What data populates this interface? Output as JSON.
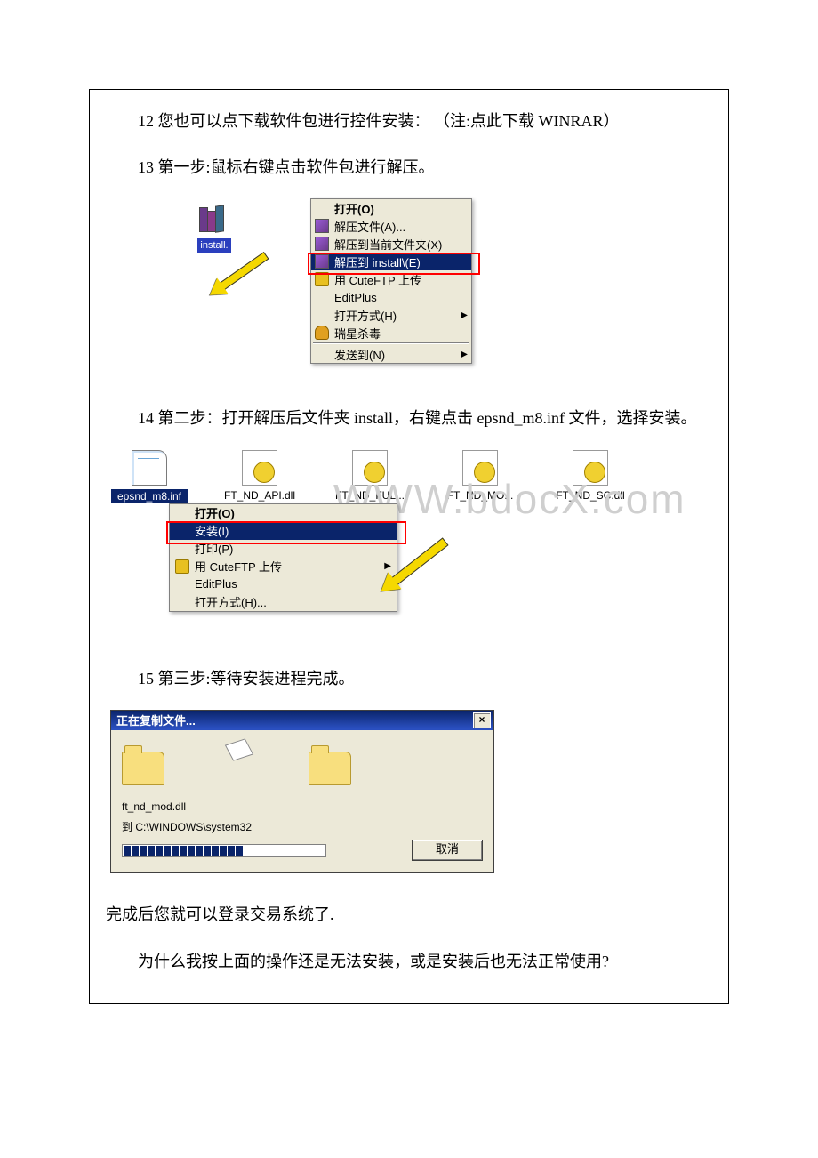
{
  "para": {
    "p12": "12 您也可以点下载软件包进行控件安装：  （注:点此下载 WINRAR）",
    "p13": "13 第一步:鼠标右键点击软件包进行解压。",
    "p14": "14 第二步：打开解压后文件夹 install，右键点击 epsnd_m8.inf 文件，选择安装。",
    "p15": "15 第三步:等待安装进程完成。",
    "done": "完成后您就可以登录交易系统了.",
    "why": "为什么我按上面的操作还是无法安装，或是安装后也无法正常使用?"
  },
  "fig1": {
    "icon_label": "install.",
    "menu": {
      "open": "打开(O)",
      "extract_files": "解压文件(A)...",
      "extract_here": "解压到当前文件夹(X)",
      "extract_install": "解压到 install\\(E)",
      "cuteftp": "用 CuteFTP 上传",
      "editplus": "EditPlus",
      "open_with": "打开方式(H)",
      "rising": "瑞星杀毒",
      "send_to": "发送到(N)"
    },
    "arrow_black": "▶"
  },
  "fig2": {
    "files": {
      "f1": "epsnd_m8.inf",
      "f2": "FT_ND_API.dll",
      "f3": "FT_ND_FUL...",
      "f4": "FT_ND_MO...",
      "f5": "FT_ND_SC.dll"
    },
    "menu": {
      "open": "打开(O)",
      "install": "安装(I)",
      "print": "打印(P)",
      "cuteftp": "用 CuteFTP 上传",
      "editplus": "EditPlus",
      "open_with": "打开方式(H)..."
    },
    "watermark": "WWW.bdocX.com",
    "arrow_black": "▶"
  },
  "fig3": {
    "title": "正在复制文件...",
    "close_x": "×",
    "line1": "ft_nd_mod.dll",
    "line2": "到 C:\\WINDOWS\\system32",
    "cancel": "取消"
  }
}
